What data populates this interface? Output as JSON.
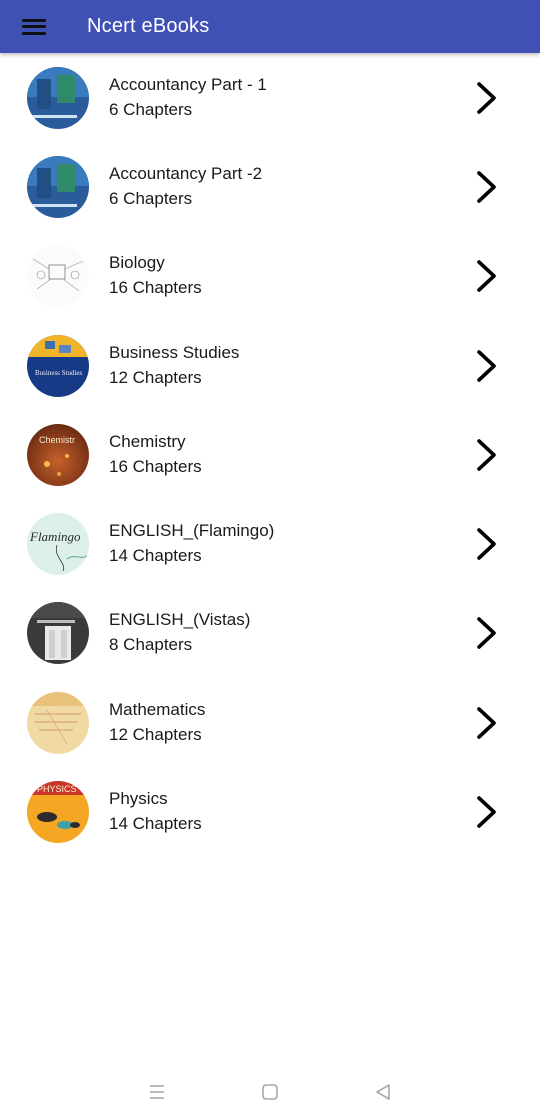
{
  "appbar": {
    "title": "Ncert eBooks",
    "color": "#3f51b5",
    "menu_icon": "hamburger-menu-icon"
  },
  "books": [
    {
      "title": "Accountancy Part - 1",
      "subtitle": "6 Chapters",
      "cover": "accountancy"
    },
    {
      "title": "Accountancy Part -2",
      "subtitle": "6 Chapters",
      "cover": "accountancy"
    },
    {
      "title": "Biology",
      "subtitle": "16 Chapters",
      "cover": "biology"
    },
    {
      "title": "Business Studies",
      "subtitle": "12 Chapters",
      "cover": "business",
      "cover_text": "Business Studies"
    },
    {
      "title": "Chemistry",
      "subtitle": "16 Chapters",
      "cover": "chemistry",
      "cover_text": "Chemistr"
    },
    {
      "title": "ENGLISH_(Flamingo)",
      "subtitle": "14 Chapters",
      "cover": "flamingo",
      "cover_text": "Flamingo"
    },
    {
      "title": "ENGLISH_(Vistas)",
      "subtitle": "8 Chapters",
      "cover": "vistas"
    },
    {
      "title": "Mathematics",
      "subtitle": "12 Chapters",
      "cover": "mathematics"
    },
    {
      "title": "Physics",
      "subtitle": "14 Chapters",
      "cover": "physics",
      "cover_text": "PHYSICS"
    }
  ],
  "row_icon": "chevron-right-icon",
  "system_nav": {
    "items": [
      "recent-apps-icon",
      "home-icon",
      "back-icon"
    ]
  }
}
